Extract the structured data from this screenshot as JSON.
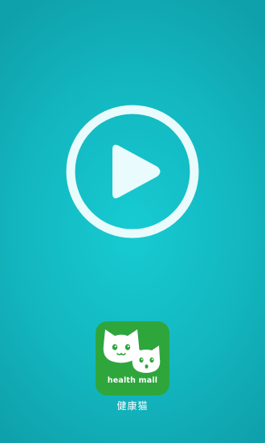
{
  "splash": {
    "play_icon": "play-circle-icon",
    "background_color": "#13b7c0",
    "play_color": "#e9fbfc"
  },
  "app": {
    "logo_icon": "cat-logo-icon",
    "logo_text": "health mall",
    "name": "健康猫",
    "logo_color": "#2ea63c"
  }
}
